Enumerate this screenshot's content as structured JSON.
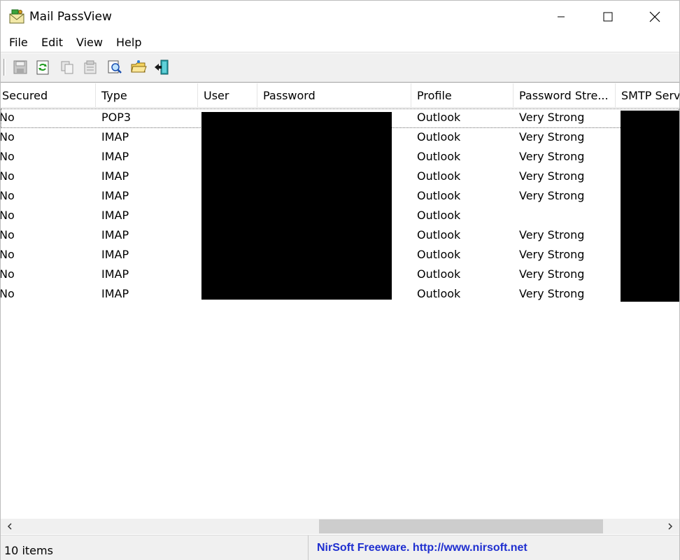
{
  "window": {
    "title": "Mail PassView",
    "icon": "envelope-key-icon"
  },
  "menu": {
    "items": [
      "File",
      "Edit",
      "View",
      "Help"
    ]
  },
  "toolbar": {
    "buttons": [
      "save-icon",
      "refresh-icon",
      "copy-icon",
      "properties-icon",
      "find-icon",
      "open-folder-icon",
      "exit-icon"
    ]
  },
  "table": {
    "columns": [
      "Secured",
      "Type",
      "User",
      "Password",
      "Profile",
      "Password Stre...",
      "SMTP Serv"
    ],
    "rows": [
      {
        "secured": "No",
        "type": "POP3",
        "profile": "Outlook",
        "strength": "Very Strong"
      },
      {
        "secured": "No",
        "type": "IMAP",
        "profile": "Outlook",
        "strength": "Very Strong"
      },
      {
        "secured": "No",
        "type": "IMAP",
        "profile": "Outlook",
        "strength": "Very Strong"
      },
      {
        "secured": "No",
        "type": "IMAP",
        "profile": "Outlook",
        "strength": "Very Strong"
      },
      {
        "secured": "No",
        "type": "IMAP",
        "profile": "Outlook",
        "strength": "Very Strong"
      },
      {
        "secured": "No",
        "type": "IMAP",
        "profile": "Outlook",
        "strength": ""
      },
      {
        "secured": "No",
        "type": "IMAP",
        "profile": "Outlook",
        "strength": "Very Strong"
      },
      {
        "secured": "No",
        "type": "IMAP",
        "profile": "Outlook",
        "strength": "Very Strong"
      },
      {
        "secured": "No",
        "type": "IMAP",
        "profile": "Outlook",
        "strength": "Very Strong"
      },
      {
        "secured": "No",
        "type": "IMAP",
        "profile": "Outlook",
        "strength": "Very Strong"
      }
    ]
  },
  "status": {
    "count": "10 items",
    "link": "NirSoft Freeware.  http://www.nirsoft.net"
  },
  "colors": {
    "link": "#1f2fd0",
    "toolbar_bg": "#f0f0f0",
    "redaction": "#000000"
  }
}
